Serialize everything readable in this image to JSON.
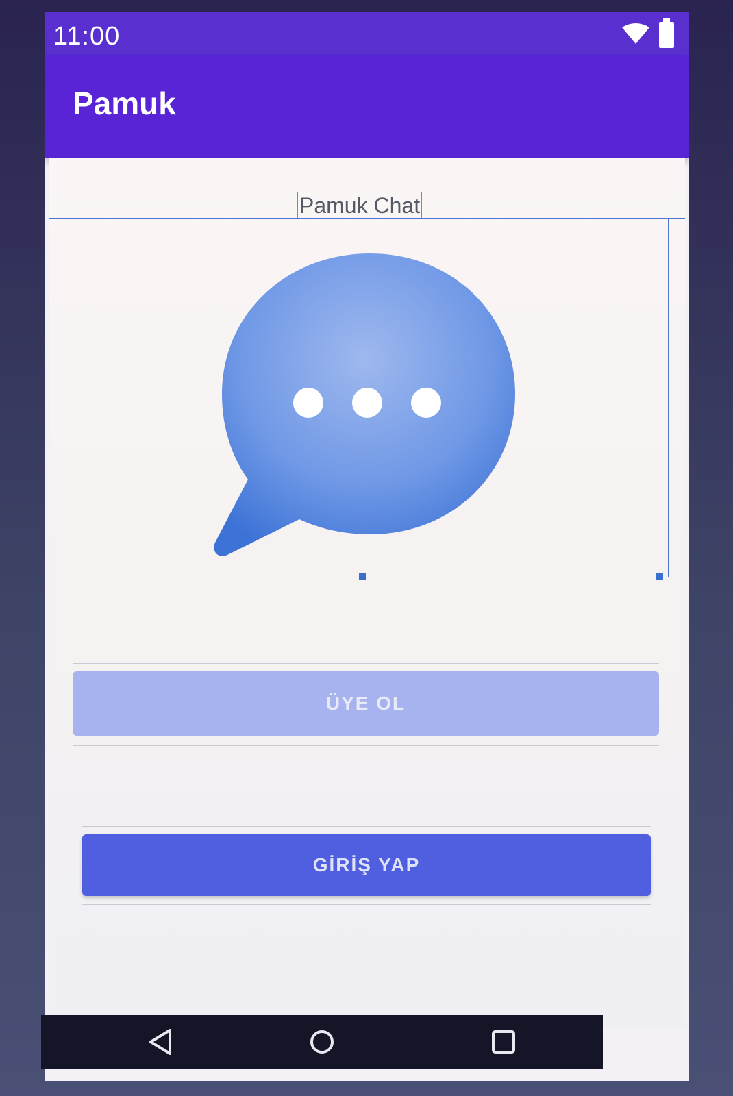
{
  "status_bar": {
    "time": "11:00",
    "icons": [
      "wifi-icon",
      "battery-icon"
    ]
  },
  "app_bar": {
    "title": "Pamuk"
  },
  "main": {
    "heading": "Pamuk Chat",
    "logo_icon": "chat-bubble-icon",
    "register_label": "ÜYE OL",
    "login_label": "GİRİŞ YAP"
  },
  "nav_bar": {
    "icons": [
      "back-icon",
      "home-icon",
      "recents-icon"
    ]
  },
  "colors": {
    "status_bar": "#5a2fd0",
    "app_bar": "#5824d6",
    "register_button": "#a7b3ee",
    "login_button": "#4f5fe0",
    "chat_bubble": "#5f8fe0"
  }
}
